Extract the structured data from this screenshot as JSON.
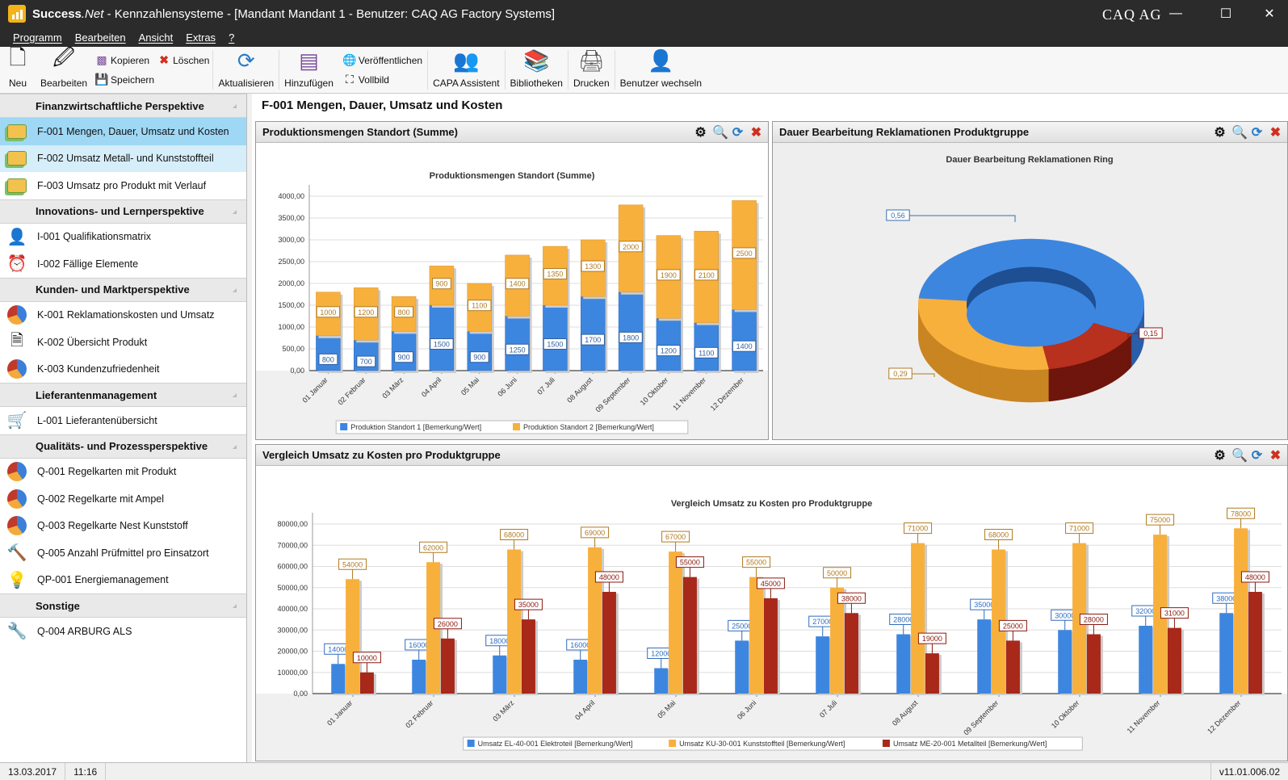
{
  "window": {
    "app_name": "Success",
    "app_suffix": ".Net",
    "title": " - Kennzahlensysteme - [Mandant Mandant 1 - Benutzer: CAQ AG Factory Systems]",
    "brand": "CAQ AG"
  },
  "menu": [
    "Programm",
    "Bearbeiten",
    "Ansicht",
    "Extras",
    "?"
  ],
  "toolbar": {
    "neu": "Neu",
    "bearbeiten": "Bearbeiten",
    "kopieren": "Kopieren",
    "loeschen": "Löschen",
    "speichern": "Speichern",
    "aktualisieren": "Aktualisieren",
    "hinzufuegen": "Hinzufügen",
    "veroeffentlichen": "Veröffentlichen",
    "vollbild": "Vollbild",
    "capa": "CAPA Assistent",
    "bibliotheken": "Bibliotheken",
    "drucken": "Drucken",
    "benutzer": "Benutzer wechseln"
  },
  "sidebar": {
    "groups": [
      {
        "label": "Finanzwirtschaftliche Perspektive",
        "items": [
          {
            "label": "F-001 Mengen, Dauer, Umsatz und Kosten",
            "icon": "money-icon",
            "state": "selected"
          },
          {
            "label": "F-002 Umsatz Metall- und Kunststoffteil",
            "icon": "money-icon",
            "state": "hover"
          },
          {
            "label": "F-003 Umsatz pro Produkt mit Verlauf",
            "icon": "money-icon"
          }
        ]
      },
      {
        "label": "Innovations- und Lernperspektive",
        "items": [
          {
            "label": "I-001 Qualifikationsmatrix",
            "icon": "user-icon"
          },
          {
            "label": "I-002 Fällige Elemente",
            "icon": "clock-icon"
          }
        ]
      },
      {
        "label": "Kunden- und Marktperspektive",
        "items": [
          {
            "label": "K-001 Reklamationskosten und Umsatz",
            "icon": "pie-chart-icon"
          },
          {
            "label": "K-002 Übersicht Produkt",
            "icon": "document-icon"
          },
          {
            "label": "K-003 Kundenzufriedenheit",
            "icon": "pie-chart-icon"
          }
        ]
      },
      {
        "label": "Lieferantenmanagement",
        "items": [
          {
            "label": "L-001 Lieferantenübersicht",
            "icon": "cart-icon"
          }
        ]
      },
      {
        "label": "Qualitäts- und Prozessperspektive",
        "items": [
          {
            "label": "Q-001 Regelkarten mit Produkt",
            "icon": "pie-chart-icon"
          },
          {
            "label": "Q-002 Regelkarte mit Ampel",
            "icon": "pie-chart-icon"
          },
          {
            "label": "Q-003 Regelkarte Nest Kunststoff",
            "icon": "pie-chart-icon"
          },
          {
            "label": "Q-005 Anzahl Prüfmittel pro Einsatzort",
            "icon": "tool-icon"
          },
          {
            "label": "QP-001 Energiemanagement",
            "icon": "bulb-icon"
          }
        ]
      },
      {
        "label": "Sonstige",
        "items": [
          {
            "label": "Q-004 ARBURG ALS",
            "icon": "wrench-icon"
          }
        ]
      }
    ]
  },
  "page_title": "F-001 Mengen, Dauer, Umsatz und Kosten",
  "panels": {
    "p1": "Produktionsmengen Standort (Summe)",
    "p2": "Dauer Bearbeitung Reklamationen Produktgruppe",
    "p3": "Vergleich Umsatz zu Kosten pro Produktgruppe"
  },
  "colors": {
    "blue": "#3d86e0",
    "orange": "#f8b03c",
    "red": "#a8281a"
  },
  "chart_data": [
    {
      "type": "bar",
      "stacked": true,
      "title": "Produktionsmengen Standort (Summe)",
      "categories": [
        "01 Januar",
        "02 Februar",
        "03 März",
        "04 April",
        "05 Mai",
        "06 Juni",
        "07 Juli",
        "08 August",
        "09 September",
        "10 Oktober",
        "11 November",
        "12 Dezember"
      ],
      "series": [
        {
          "name": "Produktion Standort 1 [Bemerkung/Wert]",
          "values": [
            800,
            700,
            900,
            1500,
            900,
            1250,
            1500,
            1700,
            1800,
            1200,
            1100,
            1400
          ]
        },
        {
          "name": "Produktion Standort 2 [Bemerkung/Wert]",
          "values": [
            1000,
            1200,
            800,
            900,
            1100,
            1400,
            1350,
            1300,
            2000,
            1900,
            2100,
            2500
          ]
        }
      ],
      "ylim": [
        0,
        4000
      ],
      "yticks": [
        "0,00",
        "500,00",
        "1000,00",
        "1500,00",
        "2000,00",
        "2500,00",
        "3000,00",
        "3500,00",
        "4000,00"
      ],
      "legend": "bottom",
      "grid": true
    },
    {
      "type": "pie",
      "donut": true,
      "title": "Dauer Bearbeitung Reklamationen Ring",
      "values": [
        0.56,
        0.15,
        0.29
      ],
      "labels": [
        "0,56",
        "0,15",
        "0,29"
      ]
    },
    {
      "type": "bar",
      "title": "Vergleich Umsatz zu Kosten pro Produktgruppe",
      "categories": [
        "01 Januar",
        "02 Februar",
        "03 März",
        "04 April",
        "05 Mai",
        "06 Juni",
        "07 Juli",
        "08 August",
        "09 September",
        "10 Oktober",
        "11 November",
        "12 Dezember"
      ],
      "series": [
        {
          "name": "Umsatz EL-40-001 Elektroteil [Bemerkung/Wert]",
          "values": [
            14000,
            16000,
            18000,
            16000,
            12000,
            25000,
            27000,
            28000,
            35000,
            30000,
            32000,
            38000
          ]
        },
        {
          "name": "Umsatz KU-30-001 Kunststoffteil [Bemerkung/Wert]",
          "values": [
            54000,
            62000,
            68000,
            69000,
            67000,
            55000,
            50000,
            71000,
            68000,
            71000,
            75000,
            78000
          ]
        },
        {
          "name": "Umsatz ME-20-001 Metallteil [Bemerkung/Wert]",
          "values": [
            10000,
            26000,
            35000,
            48000,
            55000,
            45000,
            38000,
            19000,
            25000,
            28000,
            31000,
            48000
          ]
        }
      ],
      "ylim": [
        0,
        80000
      ],
      "yticks": [
        "0,00",
        "10000,00",
        "20000,00",
        "30000,00",
        "40000,00",
        "50000,00",
        "60000,00",
        "70000,00",
        "80000,00"
      ],
      "legend": "bottom",
      "grid": true
    }
  ],
  "status": {
    "date": "13.03.2017",
    "time": "11:16",
    "version": "v11.01.006.02"
  }
}
